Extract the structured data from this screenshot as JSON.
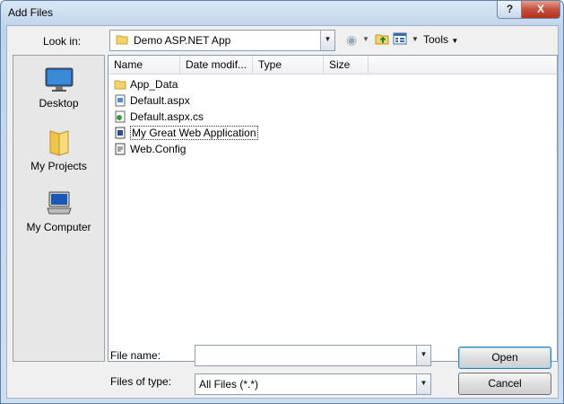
{
  "window": {
    "title": "Add Files"
  },
  "titlebar": {
    "help_glyph": "?",
    "close_glyph": "X"
  },
  "lookin": {
    "label": "Look in:",
    "value": "Demo ASP.NET App"
  },
  "toolbar": {
    "tools_label": "Tools",
    "icons": [
      "back-icon",
      "up-folder-icon",
      "views-icon"
    ]
  },
  "places": [
    {
      "label": "Desktop",
      "icon": "desktop-icon"
    },
    {
      "label": "My Projects",
      "icon": "folder-icon"
    },
    {
      "label": "My Computer",
      "icon": "computer-icon"
    }
  ],
  "columns": [
    "Name",
    "Date modif...",
    "Type",
    "Size"
  ],
  "files": [
    {
      "name": "App_Data",
      "icon": "folder-icon",
      "selected": false
    },
    {
      "name": "Default.aspx",
      "icon": "aspx-file-icon",
      "selected": false
    },
    {
      "name": "Default.aspx.cs",
      "icon": "cs-file-icon",
      "selected": false
    },
    {
      "name": "My Great Web Application",
      "icon": "project-file-icon",
      "selected": true
    },
    {
      "name": "Web.Config",
      "icon": "config-file-icon",
      "selected": false
    }
  ],
  "filename": {
    "label": "File name:",
    "value": ""
  },
  "filetype": {
    "label": "Files of type:",
    "value": "All Files (*.*)"
  },
  "buttons": {
    "open": "Open",
    "cancel": "Cancel"
  },
  "colors": {
    "selection_border": "#333333",
    "title_bg": "#bfd4ea",
    "close_red": "#c75040"
  }
}
